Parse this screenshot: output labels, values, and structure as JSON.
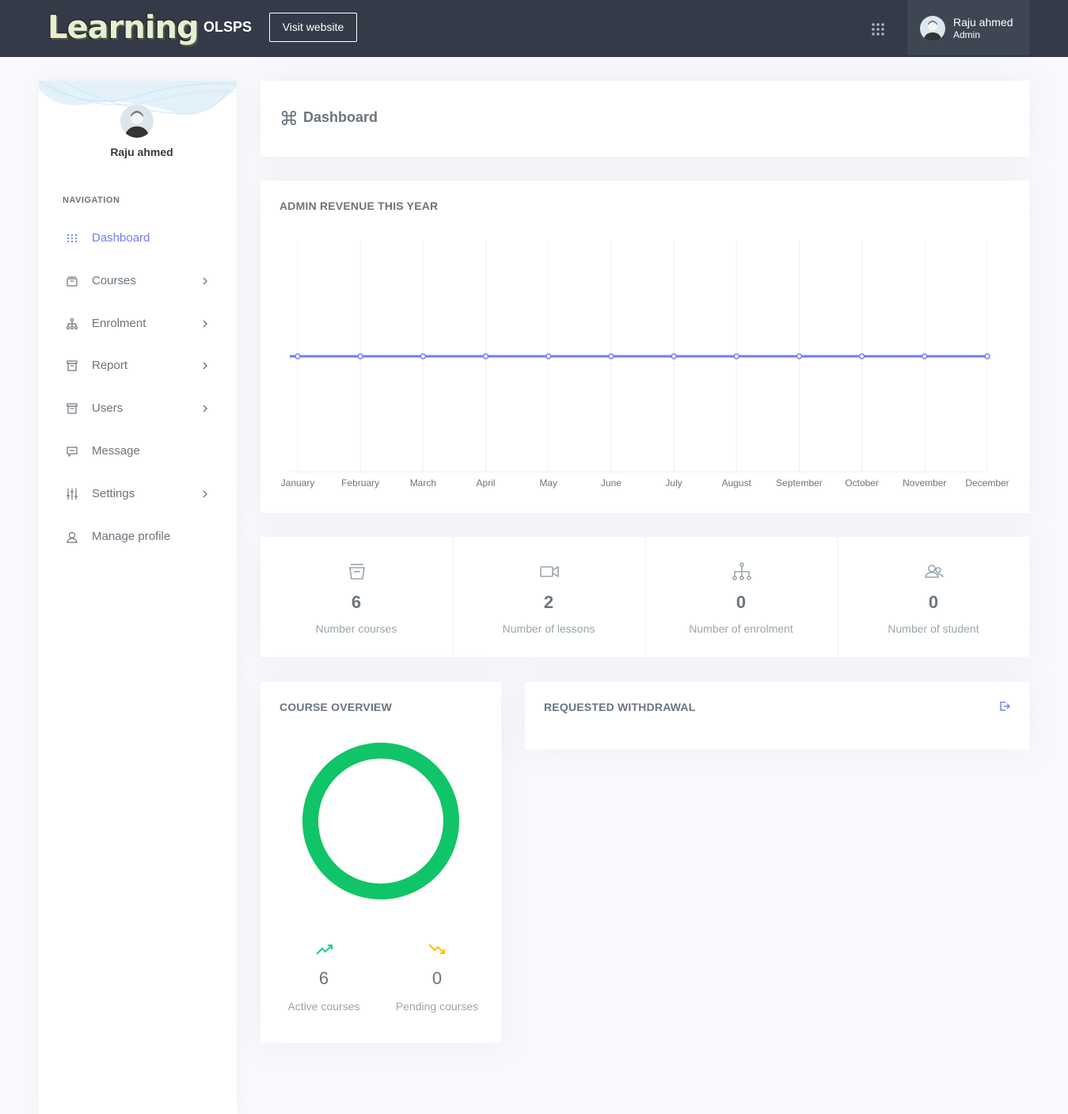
{
  "header": {
    "logo_text": "Learning",
    "system_name": "OLSPS",
    "visit_button": "Visit website",
    "apps_icon": "apps-grid-icon",
    "user_name": "Raju ahmed",
    "user_role": "Admin"
  },
  "sidebar": {
    "user_name": "Raju ahmed",
    "heading": "NAVIGATION",
    "items": [
      {
        "label": "Dashboard",
        "icon": "dots-grid-icon",
        "has_chevron": false,
        "active": true
      },
      {
        "label": "Courses",
        "icon": "archive-icon",
        "has_chevron": true,
        "active": false
      },
      {
        "label": "Enrolment",
        "icon": "network-icon",
        "has_chevron": true,
        "active": false
      },
      {
        "label": "Report",
        "icon": "box-icon",
        "has_chevron": true,
        "active": false
      },
      {
        "label": "Users",
        "icon": "box-icon",
        "has_chevron": true,
        "active": false
      },
      {
        "label": "Message",
        "icon": "chat-icon",
        "has_chevron": false,
        "active": false
      },
      {
        "label": "Settings",
        "icon": "sliders-icon",
        "has_chevron": true,
        "active": false
      },
      {
        "label": "Manage profile",
        "icon": "user-icon",
        "has_chevron": false,
        "active": false
      }
    ]
  },
  "page": {
    "title": "Dashboard",
    "title_icon": "command-icon"
  },
  "revenue": {
    "title": "ADMIN REVENUE THIS YEAR"
  },
  "chart_data": {
    "type": "line",
    "categories": [
      "January",
      "February",
      "March",
      "April",
      "May",
      "June",
      "July",
      "August",
      "September",
      "October",
      "November",
      "December"
    ],
    "series": [
      {
        "values": [
          0,
          0,
          0,
          0,
          0,
          0,
          0,
          0,
          0,
          0,
          0,
          0
        ],
        "color": "#727cf5"
      }
    ],
    "title": "ADMIN REVENUE THIS YEAR",
    "xlabel": "",
    "ylabel": "",
    "ylim": [
      -1,
      1
    ],
    "grid": "vertical",
    "legend": "none"
  },
  "stats": [
    {
      "value": "6",
      "label": "Number courses",
      "icon": "archive-icon"
    },
    {
      "value": "2",
      "label": "Number of lessons",
      "icon": "video-icon"
    },
    {
      "value": "0",
      "label": "Number of enrolment",
      "icon": "network-icon"
    },
    {
      "value": "0",
      "label": "Number of student",
      "icon": "users-icon"
    }
  ],
  "overview": {
    "title": "COURSE OVERVIEW",
    "active_fraction": 1.0,
    "ring_color": "#10c469",
    "active_value": "6",
    "active_label": "Active courses",
    "active_icon": "trending-up-icon",
    "active_color": "#0acf97",
    "pending_value": "0",
    "pending_label": "Pending courses",
    "pending_icon": "trending-down-icon",
    "pending_color": "#ffbc00"
  },
  "withdrawal": {
    "title": "REQUESTED WITHDRAWAL",
    "icon": "export-icon"
  }
}
